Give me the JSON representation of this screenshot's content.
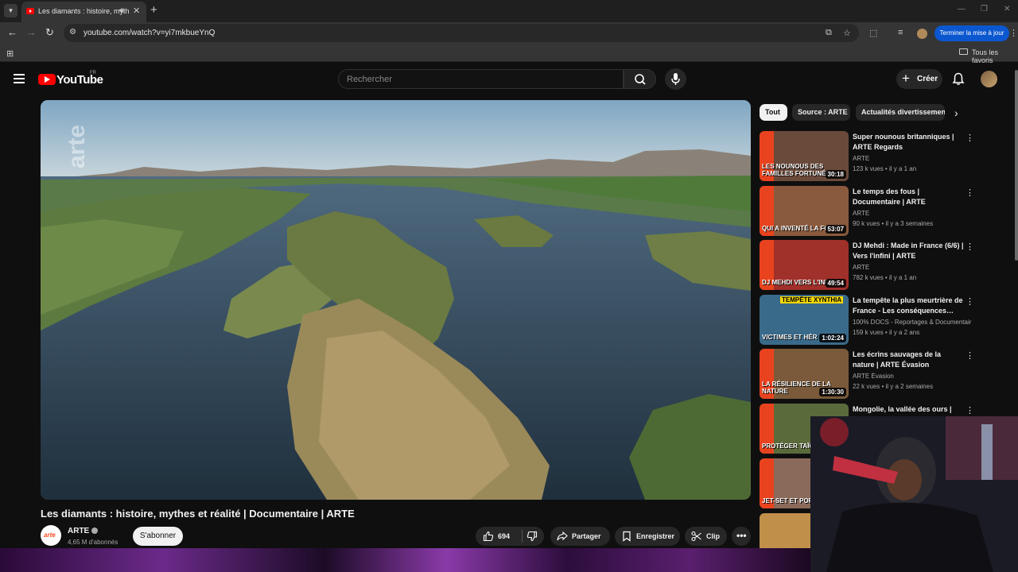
{
  "browser": {
    "tab_title": "Les diamants : histoire, myth",
    "url": "youtube.com/watch?v=yi7mkbueYnQ",
    "update_button": "Terminer la mise à jour",
    "bookmarks_label": "Tous les favoris"
  },
  "header": {
    "logo_text": "YouTube",
    "country_code": "FR",
    "search_placeholder": "Rechercher",
    "create_label": "Créer"
  },
  "video": {
    "watermark": "arte",
    "title": "Les diamants : histoire, mythes et réalité | Documentaire | ARTE",
    "channel": "ARTE",
    "channel_logo": "arte",
    "subscribers": "4,65 M d'abonnés",
    "subscribe_label": "S'abonner",
    "likes": "694",
    "share_label": "Partager",
    "save_label": "Enregistrer",
    "clip_label": "Clip"
  },
  "chips": [
    "Tout",
    "Source : ARTE",
    "Actualités divertissement"
  ],
  "recommendations": [
    {
      "title": "Super nounous britanniques | ARTE Regards",
      "channel": "ARTE",
      "views": "123 k vues",
      "age": "il y a 1 an",
      "duration": "30:18",
      "thumb_text": "LES NOUNOUS DES FAMILLES FORTUNÉES",
      "thumb_color": "#6a4a3a"
    },
    {
      "title": "Le temps des fous | Documentaire | ARTE",
      "channel": "ARTE",
      "views": "90 k vues",
      "age": "il y a 3 semaines",
      "duration": "53:07",
      "thumb_text": "QUI A INVENTÉ LA FOLIE ?",
      "thumb_color": "#8a5a3e"
    },
    {
      "title": "DJ Mehdi : Made in France (6/6) | Vers l'infini | ARTE",
      "channel": "ARTE",
      "views": "782 k vues",
      "age": "il y a 1 an",
      "duration": "49:54",
      "thumb_text": "DJ MEHDI VERS L'INFINI",
      "thumb_color": "#a0302a"
    },
    {
      "title": "La tempête la plus meurtrière de France - Les conséquences…",
      "channel": "100% DOCS - Reportages & Documentair…",
      "views": "159 k vues",
      "age": "il y a 2 ans",
      "duration": "1:02:24",
      "thumb_text": "VICTIMES ET HÉR",
      "thumb_label": "TEMPÊTE XYNTHIA",
      "thumb_color": "#3a6a8a"
    },
    {
      "title": "Les écrins sauvages de la nature | ARTE Évasion",
      "channel": "ARTE Évasion",
      "views": "22 k vues",
      "age": "il y a 2 semaines",
      "duration": "1:30:30",
      "thumb_text": "LA RÉSILIENCE DE LA NATURE",
      "thumb_color": "#7a5a3a"
    },
    {
      "title": "Mongolie, la vallée des ours |",
      "channel": "",
      "views": "",
      "age": "",
      "duration": "",
      "thumb_text": "PROTÉGER TAÏGA RO",
      "thumb_color": "#5a6a3a"
    },
    {
      "title": "",
      "channel": "",
      "views": "",
      "age": "",
      "duration": "",
      "thumb_text": "JET-SET ET PORNO",
      "thumb_color": "#8a6a5a"
    },
    {
      "title": "",
      "channel": "",
      "views": "",
      "age": "",
      "duration": "",
      "thumb_text": "",
      "thumb_color": "#c0904a"
    }
  ]
}
